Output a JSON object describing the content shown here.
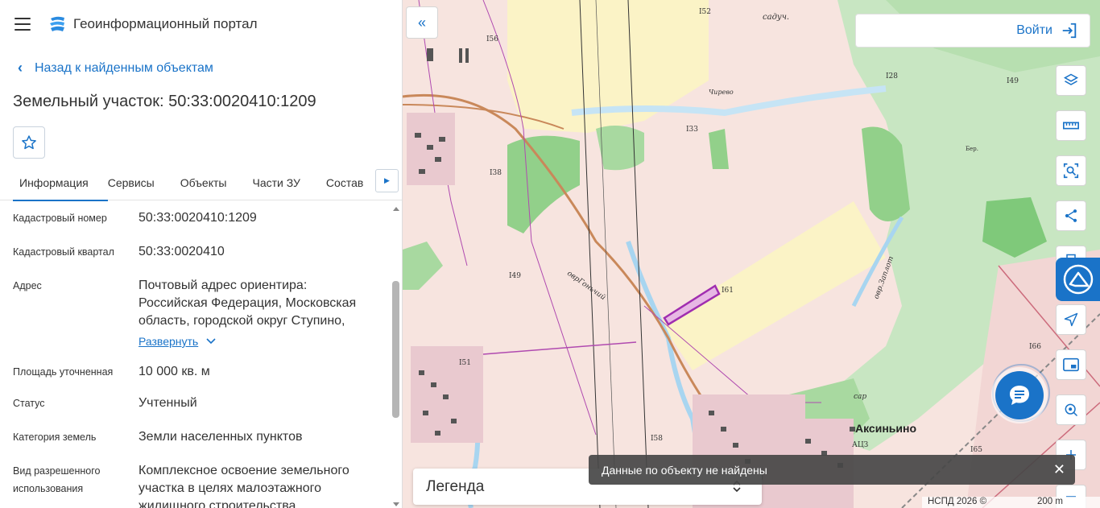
{
  "header": {
    "app_title": "Геоинформационный портал"
  },
  "nav": {
    "back_label": "Назад к найденным объектам"
  },
  "object": {
    "title": "Земельный участок: 50:33:0020410:1209"
  },
  "tabs": [
    {
      "label": "Информация",
      "active": true
    },
    {
      "label": "Сервисы"
    },
    {
      "label": "Объекты"
    },
    {
      "label": "Части ЗУ"
    },
    {
      "label": "Состав"
    }
  ],
  "info": {
    "cadastral_number": {
      "label": "Кадастровый номер",
      "value": "50:33:0020410:1209"
    },
    "cadastral_quarter": {
      "label": "Кадастровый квартал",
      "value": "50:33:0020410"
    },
    "address": {
      "label": "Адрес",
      "value": "Почтовый адрес ориентира: Российская Федерация, Московская область, городской округ Ступино,",
      "expand_label": "Развернуть"
    },
    "area": {
      "label": "Площадь уточненная",
      "value": "10 000 кв. м"
    },
    "status": {
      "label": "Статус",
      "value": "Учтенный"
    },
    "land_category": {
      "label": "Категория земель",
      "value": "Земли населенных пунктов"
    },
    "permitted_use": {
      "label_line1": "Вид разрешенного",
      "label_line2": "использования",
      "value": "Комплексное освоение земельного участка в целях малоэтажного жилищного строительства"
    }
  },
  "map": {
    "login_label": "Войти",
    "legend_label": "Легенда",
    "toast_message": "Данные по объекту не найдены",
    "copyright": "НСПД 2026 ©",
    "scale": "200 m",
    "village_name": "Аксиньино",
    "labels": [
      "садуч.",
      "I52",
      "I56",
      "I28",
      "I49",
      "I33",
      "I38",
      "Чирево",
      "Бер.",
      "I61",
      "оврГоньчий",
      "I49",
      "овр.Заплот",
      "I66",
      "I51",
      "I58",
      "сар",
      "АЦЗ",
      "I65"
    ],
    "tools": [
      "layers-icon",
      "ruler-icon",
      "area-search-icon",
      "share-icon",
      "print-icon",
      "navigate-icon",
      "picture-in-picture-icon",
      "geo-search-icon",
      "zoom-in-icon",
      "zoom-out-icon"
    ]
  },
  "colors": {
    "accent": "#1a73c8",
    "parcel_outline": "#a02db0",
    "toast_bg": "#464646"
  }
}
